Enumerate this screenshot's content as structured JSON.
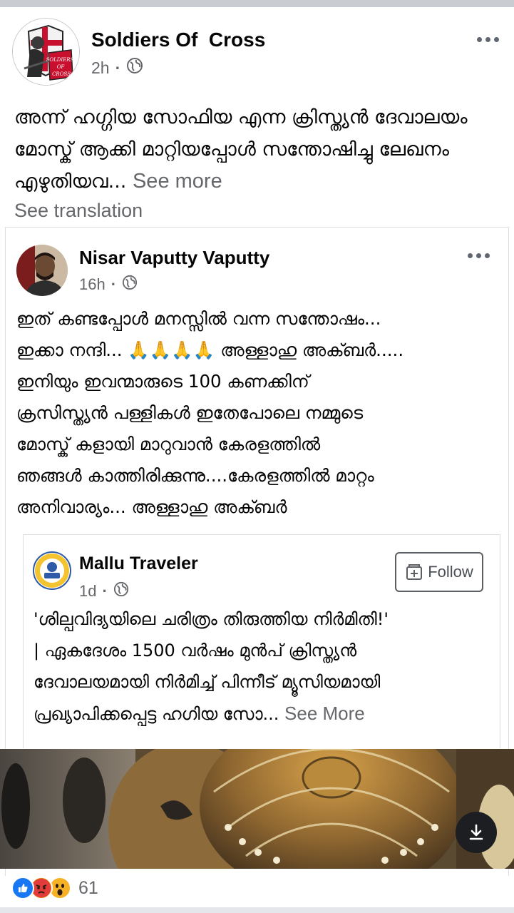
{
  "post": {
    "page_name": "Soldiers Of  Cross",
    "time": "2h",
    "text": "അന്ന് ഹഗ്ഗിയ സോഫിയ എന്ന ക്രിസ്ത്യൻ ദേവാലയം മോസ്ക് ആക്കി മാറ്റിയപ്പോൾ സന്തോഷിച്ചു ലേഖനം എഴുതിയവ",
    "ellipsis": "...",
    "see_more": "See more",
    "see_translation": "See translation",
    "avatar_logo_text": [
      "SOLDIERS",
      "OF",
      "CROSS"
    ]
  },
  "shared_post": {
    "author": "Nisar Vaputty Vaputty",
    "time": "16h",
    "line1": "ഇത് കണ്ടപ്പോൾ മനസ്സിൽ വന്ന സന്തോഷം...",
    "line2_a": "ഇക്കാ നന്ദി... ",
    "emojis": "🙏🙏🙏🙏",
    "line2_b": " അള്ളാഹു അക്ബർ.....",
    "line3": "ഇനിയും ഇവന്മാരുടെ 100 കണക്കിന്",
    "line4": "ക്രസിസ്ത്യൻ പള്ളികൾ ഇതേപോലെ നമ്മുടെ",
    "line5": "മോസ്ക് കളായി മാറുവാൻ കേരളത്തിൽ",
    "line6": "ഞങ്ങൾ കാത്തിരിക്കുന്നു....കേരളത്തിൽ മാറ്റം",
    "line7": "അനിവാര്യം... അള്ളാഹു അക്ബർ"
  },
  "inner_post": {
    "author": "Mallu Traveler",
    "time": "1d",
    "follow_label": "Follow",
    "line1": "'ശില്പവിദ്യയിലെ ചരിത്രം തിരുത്തിയ നിർമിതി!'",
    "line2": "| ഏകദേശം 1500 വർഷം മുൻപ് ക്രിസ്ത്യൻ",
    "line3": "ദേവാലയമായി നിർമിച്ച് പിന്നീട് മ്യൂസിയമായി",
    "line4": "പ്രഖ്യാപിക്കപ്പെട്ട ഹഗിയ സോ",
    "ellipsis": "... ",
    "see_more": "See More"
  },
  "reactions": {
    "types": [
      "like",
      "angry",
      "wow"
    ],
    "count": "61"
  },
  "icons": {
    "globe": "globe-icon",
    "more": "more-options-icon",
    "download": "download-icon",
    "follow": "follow-page-icon"
  },
  "colors": {
    "text_primary": "#050505",
    "text_secondary": "#65676b",
    "like_blue": "#1877f2",
    "angry_orange": "#e9710f",
    "wow_yellow": "#f7b125",
    "divider": "#c9ccd1"
  }
}
